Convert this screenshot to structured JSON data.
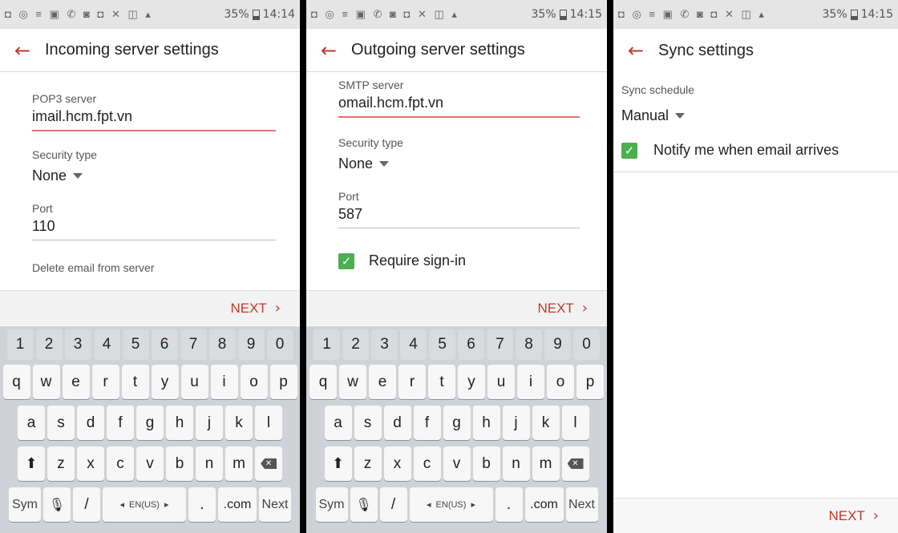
{
  "status": {
    "icons": "◘ ◎ ≡ ▣ ✆ ◙ ◘ ✕ ◫ ▴",
    "battery": "35%",
    "times": [
      "14:14",
      "14:15",
      "14:15"
    ]
  },
  "panel1": {
    "title": "Incoming server settings",
    "server_label": "POP3 server",
    "server_value": "imail.hcm.fpt.vn",
    "security_label": "Security type",
    "security_value": "None",
    "port_label": "Port",
    "port_value": "110",
    "delete_label": "Delete email from server",
    "next_label": "NEXT"
  },
  "panel2": {
    "title": "Outgoing server settings",
    "server_label": "SMTP server",
    "server_value": "omail.hcm.fpt.vn",
    "security_label": "Security type",
    "security_value": "None",
    "port_label": "Port",
    "port_value": "587",
    "signin_label": "Require sign-in",
    "next_label": "NEXT"
  },
  "panel3": {
    "title": "Sync settings",
    "schedule_label": "Sync schedule",
    "schedule_value": "Manual",
    "notify_label": "Notify me when email arrives",
    "next_label": "NEXT"
  },
  "keyboard": {
    "numbers": [
      "1",
      "2",
      "3",
      "4",
      "5",
      "6",
      "7",
      "8",
      "9",
      "0"
    ],
    "row1": [
      "q",
      "w",
      "e",
      "r",
      "t",
      "y",
      "u",
      "i",
      "o",
      "p"
    ],
    "row2": [
      "a",
      "s",
      "d",
      "f",
      "g",
      "h",
      "j",
      "k",
      "l"
    ],
    "row3": [
      "z",
      "x",
      "c",
      "v",
      "b",
      "n",
      "m"
    ],
    "sym": "Sym",
    "slash": "/",
    "lang": "EN(US)",
    "period": ".",
    "com": ".com",
    "next": "Next"
  },
  "colors": {
    "accent": "#c0392b",
    "check": "#4caf50"
  },
  "icons": {
    "back": "arrow-left-icon",
    "next": "chevron-right-icon",
    "check": "checkmark-icon",
    "shift": "shift-icon",
    "delete": "backspace-icon",
    "mic": "microphone-icon"
  }
}
